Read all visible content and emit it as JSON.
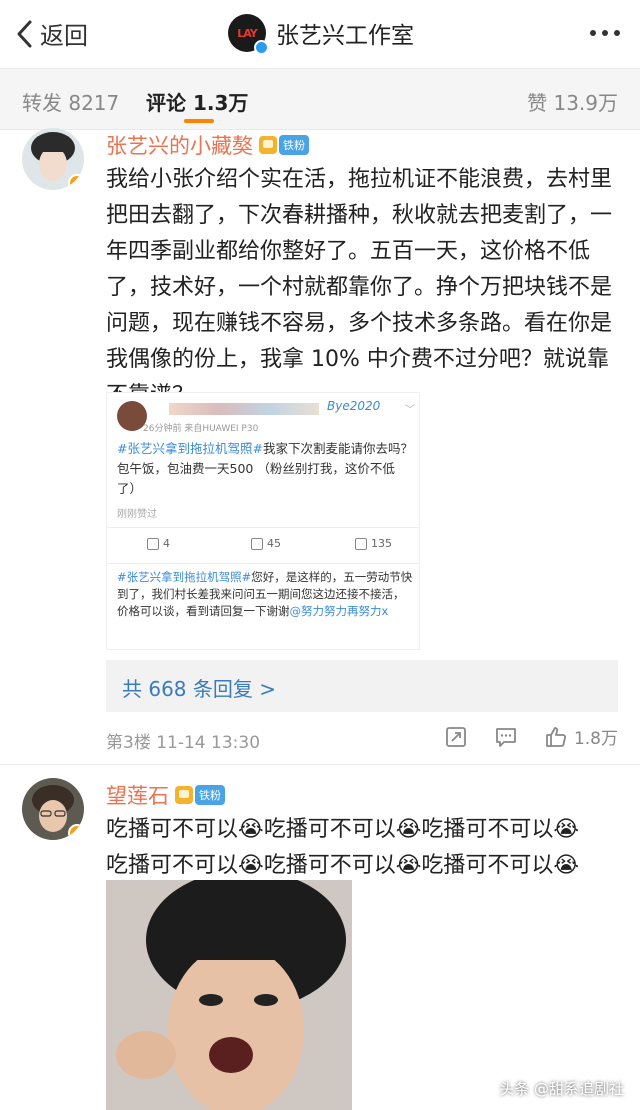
{
  "header": {
    "back_label": "返回",
    "title": "张艺兴工作室",
    "avatar_text": "LAY"
  },
  "tabs": {
    "repost": "转发 8217",
    "comment": "评论 1.3万",
    "like": "赞 13.9万",
    "accent_color": "#ff8200"
  },
  "comments": [
    {
      "username": "张艺兴的小藏獒",
      "fan_badge": "铁粉",
      "text": "我给小张介绍个实在活，拖拉机证不能浪费，去村里把田去翻了，下次春耕播种，秋收就去把麦割了，一年四季副业都给你整好了。五百一天，这价格不低了，技术好，一个村就都靠你了。挣个万把块钱不是问题，现在赚钱不容易，多个技术多条路。看在你是我偶像的份上，我拿 10% 中介费不过分吧？就说靠不靠谱？",
      "embed": {
        "name": "Bye2020",
        "meta": "26分钟前  来自HUAWEI P30",
        "text_tag": "#张艺兴拿到拖拉机驾照#",
        "text": "我家下次割麦能请你去吗？包午饭，包油费一天500 （粉丝别打我，这价不低了）",
        "liked": "刚刚赞过",
        "reposts": "4",
        "comments": "45",
        "likes": "135",
        "reply_tag": "#张艺兴拿到拖拉机驾照#",
        "reply_text": "您好，是这样的，五一劳动节快到了，我们村长差我来问问五一期间您这边还接不接活，价格可以谈，看到请回复一下谢谢",
        "reply_mention": "@努力努力再努力x"
      },
      "replies_label": "共 668 条回复 >",
      "meta": "第3楼  11-14 13:30",
      "like_count": "1.8万"
    },
    {
      "username": "望莲石",
      "fan_badge": "铁粉",
      "line1": "吃播可不可以😭吃播可不可以😭吃播可不可以😭",
      "line2": "吃播可不可以😭吃播可不可以😭吃播可不可以😭"
    }
  ],
  "watermark": "头条 @甜系追剧社"
}
